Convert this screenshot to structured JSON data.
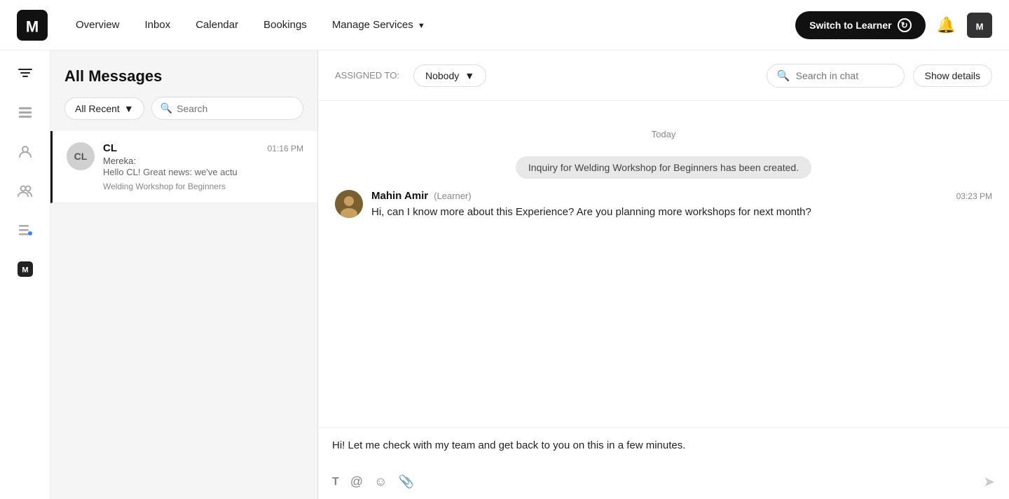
{
  "topnav": {
    "logo_alt": "Mereka logo",
    "links": [
      {
        "label": "Overview",
        "key": "overview"
      },
      {
        "label": "Inbox",
        "key": "inbox"
      },
      {
        "label": "Calendar",
        "key": "calendar"
      },
      {
        "label": "Bookings",
        "key": "bookings"
      },
      {
        "label": "Manage Services",
        "key": "manage-services",
        "has_arrow": true
      }
    ],
    "switch_label": "Switch to Learner",
    "avatar_alt": "mereka"
  },
  "sidebar": {
    "icons": [
      {
        "name": "filter-icon",
        "symbol": "⊞"
      },
      {
        "name": "list-icon",
        "symbol": "☰"
      },
      {
        "name": "person-icon",
        "symbol": "👤"
      },
      {
        "name": "group-icon",
        "symbol": "👥"
      },
      {
        "name": "list-check-icon",
        "symbol": "📋"
      },
      {
        "name": "mereka-logo-icon",
        "symbol": "M"
      }
    ]
  },
  "messages_panel": {
    "title": "All Messages",
    "filter": {
      "label": "All Recent",
      "placeholder": "Search"
    },
    "conversations": [
      {
        "id": "cl",
        "initials": "CL",
        "name": "CL",
        "time": "01:16 PM",
        "sender": "Mereka:",
        "preview": "Hello CL! Great news: we've actu",
        "tag": "Welding Workshop for Beginners"
      }
    ]
  },
  "chat": {
    "assigned_label": "ASSIGNED TO:",
    "assigned_value": "Nobody",
    "search_placeholder": "Search in chat",
    "show_details_label": "Show details",
    "date_divider": "Today",
    "system_message": "Inquiry for Welding Workshop for Beginners has been created.",
    "messages": [
      {
        "id": "msg1",
        "sender_name": "Mahin Amir",
        "sender_role": "(Learner)",
        "time": "03:23 PM",
        "text": "Hi, can I know more about this Experience? Are you planning more workshops for next month?",
        "avatar_bg": "#8B6914"
      }
    ],
    "composer": {
      "value": "Hi! Let me check with my team and get back to you on this in a few minutes.",
      "toolbar_icons": [
        {
          "name": "bold-icon",
          "symbol": "T",
          "bold": true
        },
        {
          "name": "mention-icon",
          "symbol": "@"
        },
        {
          "name": "emoji-icon",
          "symbol": "☺"
        },
        {
          "name": "attach-icon",
          "symbol": "📎"
        }
      ]
    }
  }
}
